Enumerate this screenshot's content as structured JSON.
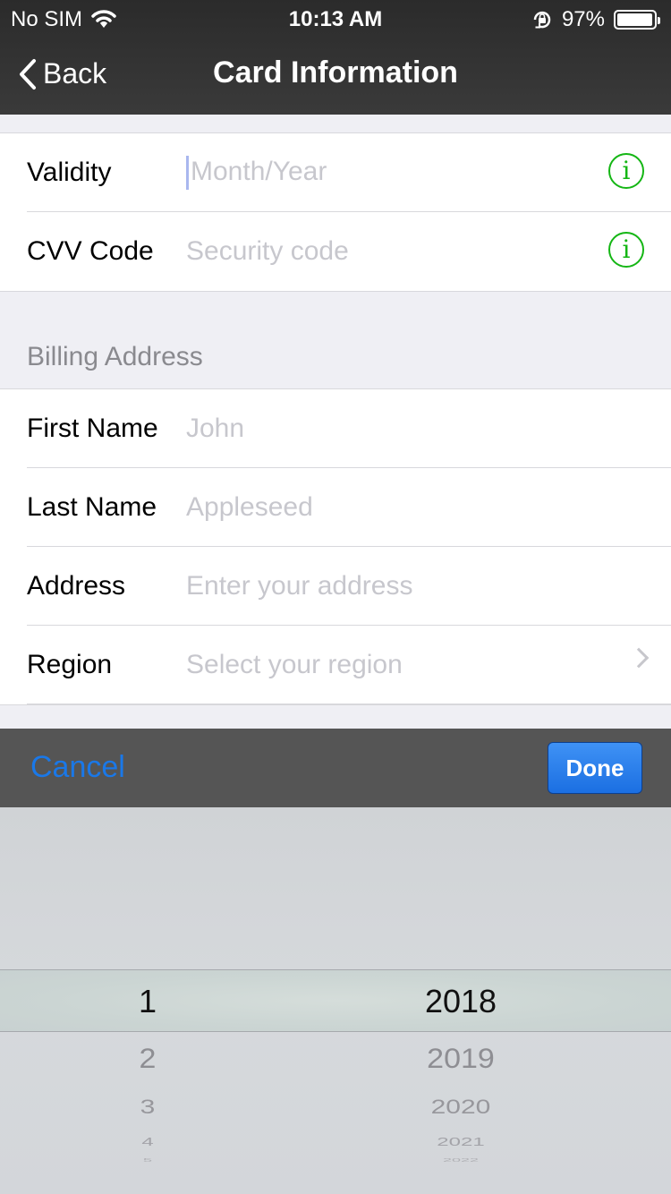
{
  "status": {
    "carrier": "No SIM",
    "time": "10:13 AM",
    "battery": "97%",
    "battery_level": 0.97
  },
  "nav": {
    "back_label": "Back",
    "title": "Card Information"
  },
  "card_rows": [
    {
      "label": "Validity",
      "placeholder": "Month/Year"
    },
    {
      "label": "CVV Code",
      "placeholder": "Security code"
    }
  ],
  "billing": {
    "header": "Billing Address",
    "rows": [
      {
        "label": "First Name",
        "placeholder": "John"
      },
      {
        "label": "Last Name",
        "placeholder": "Appleseed"
      },
      {
        "label": "Address",
        "placeholder": "Enter your address"
      },
      {
        "label": "Region",
        "placeholder": "Select your region"
      }
    ]
  },
  "toolbar": {
    "cancel_label": "Cancel",
    "done_label": "Done"
  },
  "picker": {
    "months": [
      "1",
      "2",
      "3",
      "4",
      "5"
    ],
    "years": [
      "2018",
      "2019",
      "2020",
      "2021",
      "2022"
    ]
  },
  "colors": {
    "accent": "#1a78e8",
    "info_green": "#14b614",
    "nav_bg": "#333333"
  },
  "icons": {
    "back": "chevron-left-icon",
    "info": "info-icon",
    "disclosure": "chevron-right-icon"
  }
}
